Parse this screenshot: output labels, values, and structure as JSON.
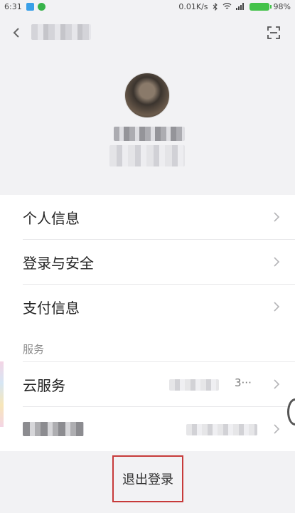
{
  "status_bar": {
    "time": "6:31",
    "network_speed": "0.01K/s",
    "battery": "98%"
  },
  "nav": {
    "back_icon": "chevron-left-icon",
    "scan_icon": "scan-frame-icon"
  },
  "menu_group_1": [
    {
      "label": "个人信息"
    },
    {
      "label": "登录与安全"
    },
    {
      "label": "支付信息"
    }
  ],
  "menu_group_2": {
    "header": "服务",
    "items": [
      {
        "label": "云服务",
        "value": "3···"
      }
    ]
  },
  "logout": {
    "label": "退出登录"
  },
  "colors": {
    "highlight_border": "#c73a3a",
    "battery_green": "#44c24a"
  }
}
